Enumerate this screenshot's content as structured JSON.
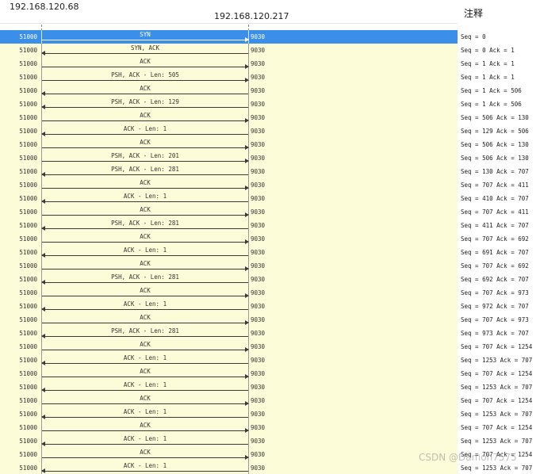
{
  "header": {
    "host_a": "192.168.120.68",
    "host_b": "192.168.120.217",
    "comment_title": "注释"
  },
  "port_a": "51000",
  "port_b": "9030",
  "rows": [
    {
      "label": "SYN",
      "dir": "right",
      "note": "Seq = 0",
      "selected": true
    },
    {
      "label": "SYN, ACK",
      "dir": "left",
      "note": "Seq = 0 Ack = 1"
    },
    {
      "label": "ACK",
      "dir": "right",
      "note": "Seq = 1 Ack = 1"
    },
    {
      "label": "PSH, ACK - Len: 505",
      "dir": "right",
      "note": "Seq = 1 Ack = 1"
    },
    {
      "label": "ACK",
      "dir": "left",
      "note": "Seq = 1 Ack = 506"
    },
    {
      "label": "PSH, ACK - Len: 129",
      "dir": "left",
      "note": "Seq = 1 Ack = 506"
    },
    {
      "label": "ACK",
      "dir": "right",
      "note": "Seq = 506 Ack = 130"
    },
    {
      "label": "ACK - Len: 1",
      "dir": "left",
      "note": "Seq = 129 Ack = 506"
    },
    {
      "label": "ACK",
      "dir": "right",
      "note": "Seq = 506 Ack = 130"
    },
    {
      "label": "PSH, ACK - Len: 201",
      "dir": "right",
      "note": "Seq = 506 Ack = 130"
    },
    {
      "label": "PSH, ACK - Len: 281",
      "dir": "left",
      "note": "Seq = 130 Ack = 707"
    },
    {
      "label": "ACK",
      "dir": "right",
      "note": "Seq = 707 Ack = 411"
    },
    {
      "label": "ACK - Len: 1",
      "dir": "left",
      "note": "Seq = 410 Ack = 707"
    },
    {
      "label": "ACK",
      "dir": "right",
      "note": "Seq = 707 Ack = 411"
    },
    {
      "label": "PSH, ACK - Len: 281",
      "dir": "left",
      "note": "Seq = 411 Ack = 707"
    },
    {
      "label": "ACK",
      "dir": "right",
      "note": "Seq = 707 Ack = 692"
    },
    {
      "label": "ACK - Len: 1",
      "dir": "left",
      "note": "Seq = 691 Ack = 707"
    },
    {
      "label": "ACK",
      "dir": "right",
      "note": "Seq = 707 Ack = 692"
    },
    {
      "label": "PSH, ACK - Len: 281",
      "dir": "left",
      "note": "Seq = 692 Ack = 707"
    },
    {
      "label": "ACK",
      "dir": "right",
      "note": "Seq = 707 Ack = 973"
    },
    {
      "label": "ACK - Len: 1",
      "dir": "left",
      "note": "Seq = 972 Ack = 707"
    },
    {
      "label": "ACK",
      "dir": "right",
      "note": "Seq = 707 Ack = 973"
    },
    {
      "label": "PSH, ACK - Len: 281",
      "dir": "left",
      "note": "Seq = 973 Ack = 707"
    },
    {
      "label": "ACK",
      "dir": "right",
      "note": "Seq = 707 Ack = 1254"
    },
    {
      "label": "ACK - Len: 1",
      "dir": "left",
      "note": "Seq = 1253 Ack = 707"
    },
    {
      "label": "ACK",
      "dir": "right",
      "note": "Seq = 707 Ack = 1254"
    },
    {
      "label": "ACK - Len: 1",
      "dir": "left",
      "note": "Seq = 1253 Ack = 707"
    },
    {
      "label": "ACK",
      "dir": "right",
      "note": "Seq = 707 Ack = 1254"
    },
    {
      "label": "ACK - Len: 1",
      "dir": "left",
      "note": "Seq = 1253 Ack = 707"
    },
    {
      "label": "ACK",
      "dir": "right",
      "note": "Seq = 707 Ack = 1254"
    },
    {
      "label": "ACK - Len: 1",
      "dir": "left",
      "note": "Seq = 1253 Ack = 707"
    },
    {
      "label": "ACK",
      "dir": "right",
      "note": "Seq = 707 Ack = 1254"
    },
    {
      "label": "ACK - Len: 1",
      "dir": "left",
      "note": "Seq = 1253 Ack = 707"
    }
  ],
  "watermark": "CSDN @Damon7575"
}
